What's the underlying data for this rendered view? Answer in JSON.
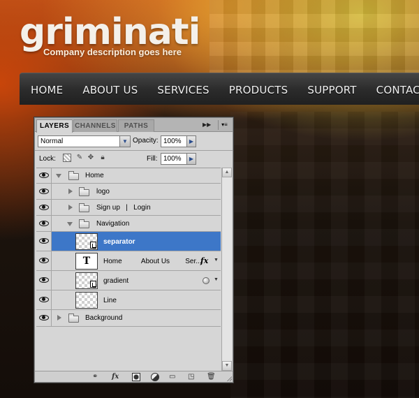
{
  "site": {
    "logo": "griminati",
    "tagline": "Company description goes here"
  },
  "nav": {
    "items": [
      "HOME",
      "ABOUT US",
      "SERVICES",
      "PRODUCTS",
      "SUPPORT",
      "CONTACT"
    ]
  },
  "panel": {
    "tabs": [
      "LAYERS",
      "CHANNELS",
      "PATHS"
    ],
    "active_tab": "LAYERS",
    "blend_mode": "Normal",
    "opacity_label": "Opacity:",
    "opacity": "100%",
    "lock_label": "Lock:",
    "fill_label": "Fill:",
    "fill": "100%",
    "layers": [
      {
        "name": "Home",
        "kind": "group",
        "expanded": true,
        "depth": 0
      },
      {
        "name": "logo",
        "kind": "group",
        "expanded": false,
        "depth": 1
      },
      {
        "name": "Sign up   |   Login",
        "kind": "group",
        "expanded": false,
        "depth": 1
      },
      {
        "name": "Navigation",
        "kind": "group",
        "expanded": true,
        "depth": 1
      },
      {
        "name": "separator",
        "kind": "smart-object",
        "selected": true,
        "depth": 2
      },
      {
        "name": "Home          About Us        Ser...",
        "kind": "text",
        "has_fx": true,
        "depth": 2
      },
      {
        "name": "gradient",
        "kind": "smart-object",
        "has_style": true,
        "depth": 2
      },
      {
        "name": "Line",
        "kind": "pixel",
        "depth": 2
      },
      {
        "name": "Background",
        "kind": "group",
        "expanded": false,
        "depth": 0
      }
    ],
    "icons": {
      "collapse": "double-chevron-right-icon",
      "menu": "panel-menu-icon",
      "visibility": "eye-icon",
      "footer": [
        "link-icon",
        "fx-icon",
        "mask-icon",
        "adjustment-icon",
        "group-folder-icon",
        "new-layer-icon",
        "trash-icon"
      ]
    },
    "colors": {
      "selection": "#3d77c8",
      "panel_bg": "#d6d6d6"
    }
  }
}
